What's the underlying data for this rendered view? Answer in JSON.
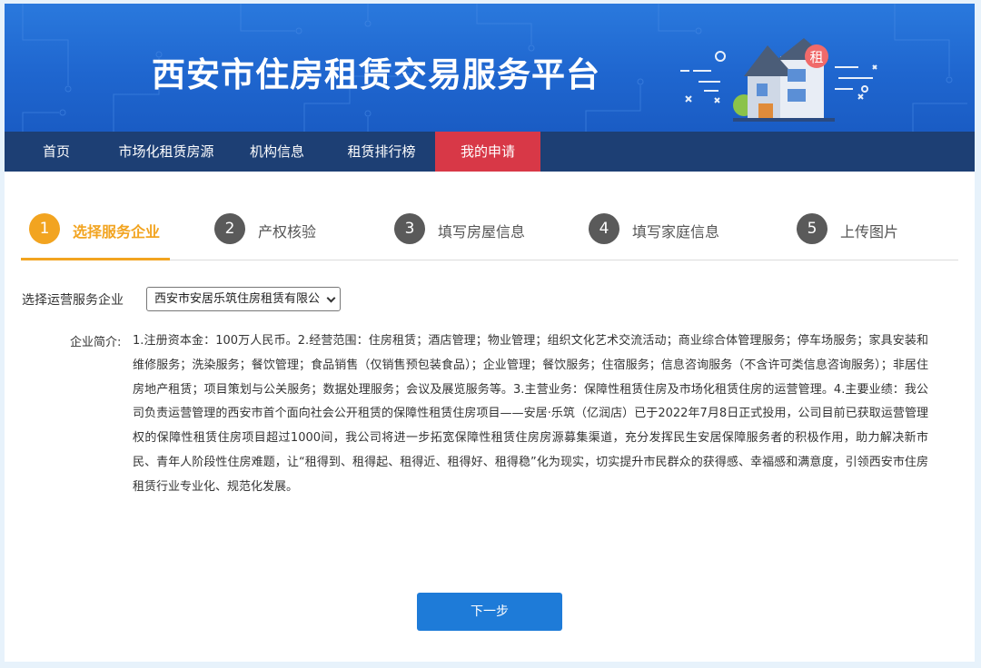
{
  "header": {
    "site_title": "西安市住房租赁交易服务平台",
    "house_badge": "租"
  },
  "nav": {
    "items": [
      {
        "label": "首页"
      },
      {
        "label": "市场化租赁房源"
      },
      {
        "label": "机构信息"
      },
      {
        "label": "租赁排行榜"
      },
      {
        "label": "我的申请"
      }
    ],
    "active_index": 4
  },
  "steps": [
    {
      "number": "1",
      "label": "选择服务企业",
      "active": true
    },
    {
      "number": "2",
      "label": "产权核验"
    },
    {
      "number": "3",
      "label": "填写房屋信息"
    },
    {
      "number": "4",
      "label": "填写家庭信息"
    },
    {
      "number": "5",
      "label": "上传图片"
    }
  ],
  "form": {
    "select_label": "选择运营服务企业",
    "selected_company": "西安市安居乐筑住房租赁有限公"
  },
  "intro": {
    "label": "企业简介:",
    "text": "1.注册资本金：100万人民币。2.经营范围：住房租赁；酒店管理；物业管理；组织文化艺术交流活动；商业综合体管理服务；停车场服务；家具安装和维修服务；洗染服务；餐饮管理；食品销售（仅销售预包装食品）；企业管理；餐饮服务；住宿服务；信息咨询服务（不含许可类信息咨询服务）；非居住房地产租赁；项目策划与公关服务；数据处理服务；会议及展览服务等。3.主营业务：保障性租赁住房及市场化租赁住房的运营管理。4.主要业绩：我公司负责运营管理的西安市首个面向社会公开租赁的保障性租赁住房项目——安居·乐筑（亿润店）已于2022年7月8日正式投用，公司目前已获取运营管理权的保障性租赁住房项目超过1000间，我公司将进一步拓宽保障性租赁住房房源募集渠道，充分发挥民生安居保障服务者的积极作用，助力解决新市民、青年人阶段性住房难题，让“租得到、租得起、租得近、租得好、租得稳”化为现实，切实提升市民群众的获得感、幸福感和满意度，引领西安市住房租赁行业专业化、规范化发展。"
  },
  "actions": {
    "next_label": "下一步"
  },
  "colors": {
    "banner": "#1f66cf",
    "nav": "#1d3f74",
    "nav_active": "#d83847",
    "step_active": "#f2a420",
    "button": "#1e7bd8"
  }
}
